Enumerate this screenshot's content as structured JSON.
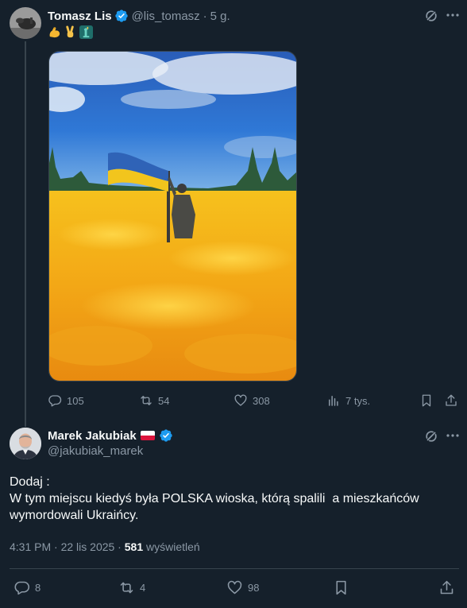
{
  "parent_tweet": {
    "author_name": "Tomasz Lis",
    "handle": "@lis_tomasz",
    "separator": "·",
    "time_ago": "5 g.",
    "emojis": [
      "flexed-biceps",
      "victory-hand",
      "statue-of-liberty"
    ],
    "media_description_icon": "ukraine-flag-field-photo",
    "stats": {
      "replies": "105",
      "reposts": "54",
      "likes": "308",
      "views": "7 tys."
    }
  },
  "main_tweet": {
    "author_name": "Marek Jakubiak",
    "flag": "poland-flag",
    "handle": "@jakubiak_marek",
    "text_line1": "Dodaj :",
    "text_line2": "W tym miejscu kiedyś była POLSKA wioska, którą spalili  a mieszkańców wymordowali Ukraińcy.",
    "timestamp": "4:31 PM · 22 lis 2025 ·",
    "views_count": "581",
    "views_label": "wyświetleń",
    "stats": {
      "replies": "8",
      "reposts": "4",
      "likes": "98"
    }
  },
  "colors": {
    "background": "#15202b",
    "text": "#f7f9f9",
    "muted": "#8b98a5",
    "verified": "#1d9bf0",
    "border": "#38444d"
  }
}
